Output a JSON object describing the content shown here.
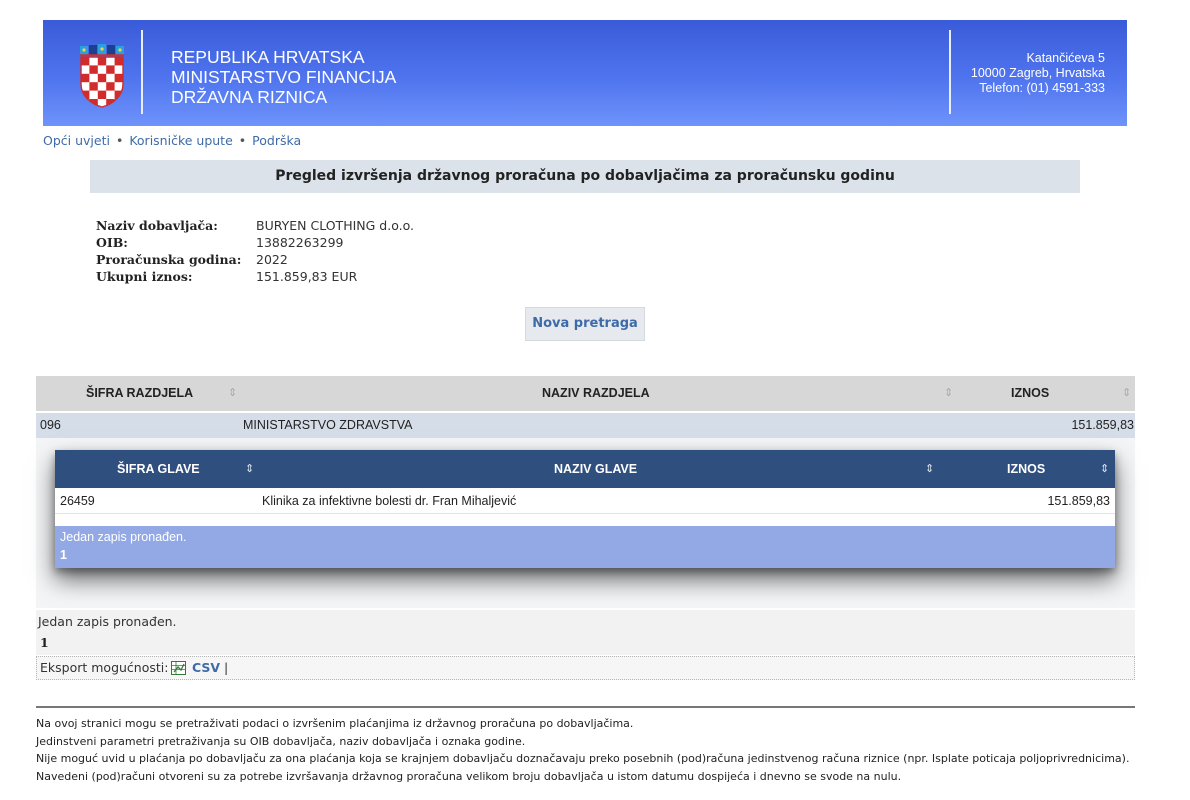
{
  "header": {
    "title_lines": [
      "REPUBLIKA HRVATSKA",
      "MINISTARSTVO FINANCIJA",
      "DRŽAVNA RIZNICA"
    ],
    "address_lines": [
      "Katančićeva 5",
      "10000 Zagreb, Hrvatska",
      "Telefon: (01) 4591-333"
    ],
    "crest_icon": "croatian-coat-of-arms-icon",
    "gradient": [
      "#3a5bd9",
      "#6e93fa"
    ]
  },
  "toplinks": {
    "items": [
      "Opći uvjeti",
      "Korisničke upute",
      "Podrška"
    ],
    "separator": "•"
  },
  "page_title": "Pregled izvršenja državnog proračuna po dobavljačima za proračunsku godinu",
  "supplier": {
    "labels": [
      "Naziv dobavljača:",
      "OIB:",
      "Proračunska godina:",
      "Ukupni iznos:"
    ],
    "values": [
      "BURYEN CLOTHING d.o.o.",
      "13882263299",
      "2022",
      "151.859,83 EUR"
    ]
  },
  "new_search_label": "Nova pretraga",
  "outer_table": {
    "headers": [
      "ŠIFRA RAZDJELA",
      "NAZIV RAZDJELA",
      "IZNOS"
    ],
    "sort_icon": "sort-arrows-icon",
    "row": [
      "096",
      "MINISTARSTVO ZDRAVSTVA",
      "151.859,83"
    ],
    "footer_text": "Jedan zapis pronađen.",
    "page": "1"
  },
  "inner_table": {
    "headers": [
      "ŠIFRA GLAVE",
      "NAZIV GLAVE",
      "IZNOS"
    ],
    "row": [
      "26459",
      "Klinika za infektivne bolesti dr. Fran Mihaljević",
      "151.859,83"
    ],
    "footer_text": "Jedan zapis pronađen.",
    "page": "1",
    "header_color": "#2f4f7f",
    "footer_color": "#93a9e6"
  },
  "export": {
    "label": "Eksport mogućnosti:",
    "csv_label": "CSV",
    "separator": "|",
    "csv_icon": "spreadsheet-icon"
  },
  "footer_lines": [
    "Na ovoj stranici mogu se pretraživati podaci o izvršenim plaćanjima iz državnog proračuna po dobavljačima.",
    "Jedinstveni parametri pretraživanja su OIB dobavljača, naziv dobavljača i oznaka godine.",
    "Nije moguć uvid u plaćanja po dobavljaču za ona plaćanja koja se krajnjem dobavljaču doznačavaju preko posebnih (pod)računa jedinstvenog računa riznice (npr. Isplate poticaja poljoprivrednicima).",
    "Navedeni (pod)računi otvoreni su za potrebe izvršavanja državnog proračuna velikom broju dobavljača u istom datumu dospijeća i dnevno se svode na nulu."
  ]
}
